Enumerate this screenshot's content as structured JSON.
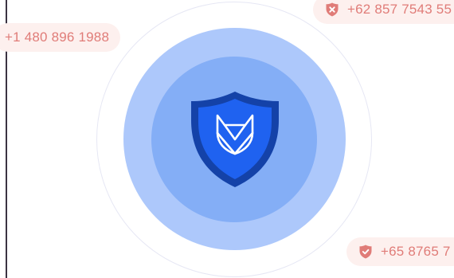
{
  "numbers": {
    "left": "+1 480 896 1988",
    "top_right": "+62 857 7543 55",
    "bottom_right": "+65 8765 7"
  },
  "icons": {
    "center": "fox-shield-icon",
    "blocked": "shield-x-icon",
    "verified": "shield-check-icon"
  },
  "colors": {
    "pill_bg": "#fdf0ee",
    "pill_text": "#e07c78",
    "ring_mid": "#adc8fb",
    "ring_inner": "#84aef6",
    "shield_outer": "#1442a8",
    "shield_inner": "#1f62f0"
  }
}
